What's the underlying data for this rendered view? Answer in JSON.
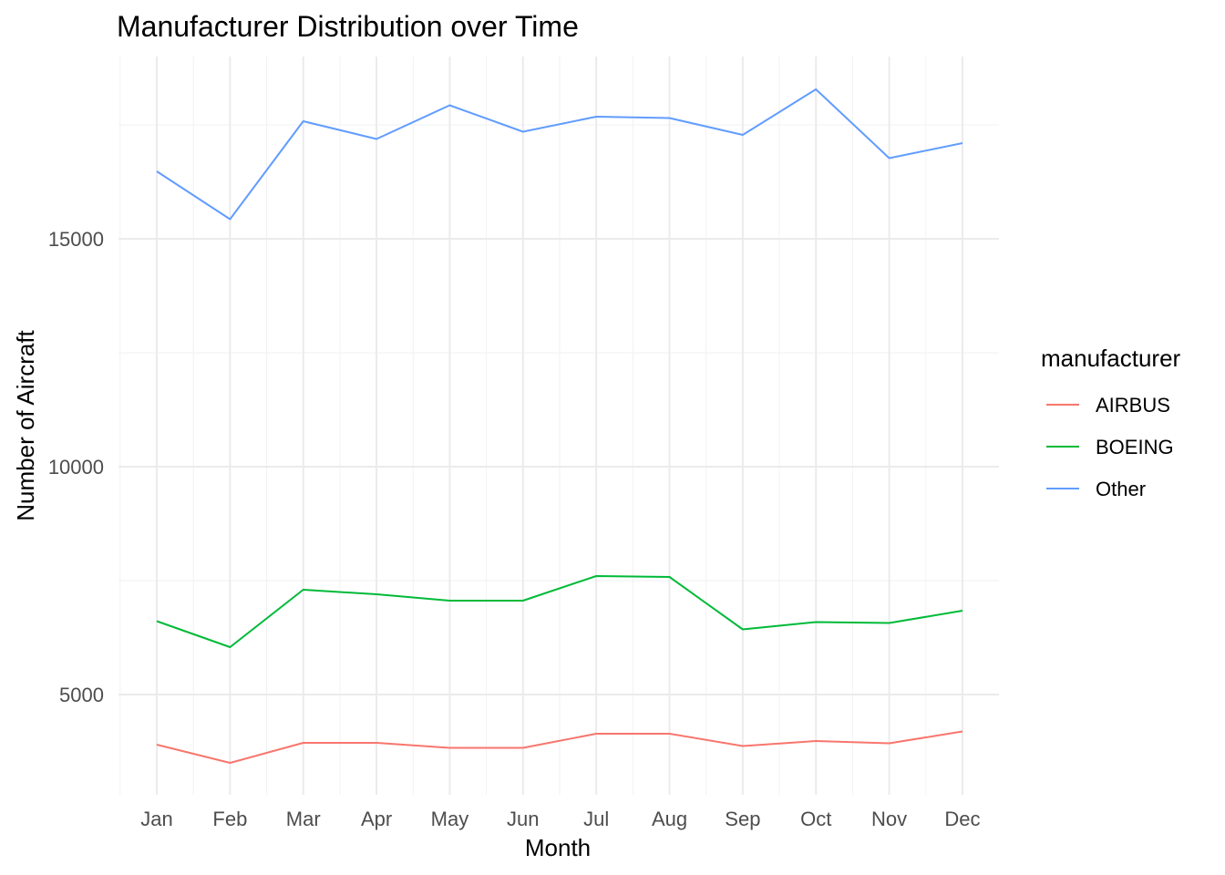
{
  "chart_data": {
    "type": "line",
    "title": "Manufacturer Distribution over Time",
    "xlabel": "Month",
    "ylabel": "Number of Aircraft",
    "categories": [
      "Jan",
      "Feb",
      "Mar",
      "Apr",
      "May",
      "Jun",
      "Jul",
      "Aug",
      "Sep",
      "Oct",
      "Nov",
      "Dec"
    ],
    "ylim": [
      2800,
      19000
    ],
    "yticks": [
      5000,
      10000,
      15000
    ],
    "grid": true,
    "legend": {
      "title": "manufacturer",
      "placement": "right"
    },
    "series": [
      {
        "name": "AIRBUS",
        "color": "#F8766D",
        "values": [
          3900,
          3500,
          3940,
          3940,
          3830,
          3830,
          4140,
          4140,
          3870,
          3980,
          3930,
          4190
        ]
      },
      {
        "name": "BOEING",
        "color": "#00BA38",
        "values": [
          6610,
          6040,
          7300,
          7200,
          7060,
          7060,
          7600,
          7580,
          6430,
          6590,
          6570,
          6840
        ]
      },
      {
        "name": "Other",
        "color": "#619CFF",
        "values": [
          16480,
          15430,
          17580,
          17190,
          17930,
          17350,
          17680,
          17650,
          17280,
          18280,
          16770,
          17100
        ]
      }
    ]
  }
}
